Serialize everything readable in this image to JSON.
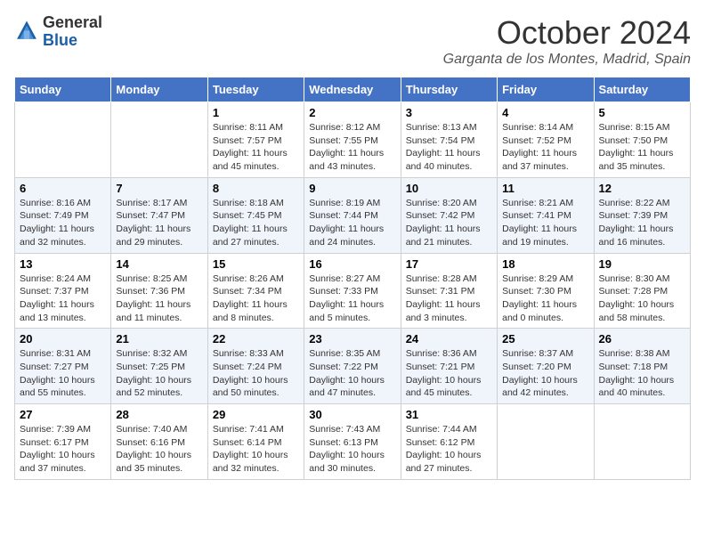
{
  "header": {
    "logo_line1": "General",
    "logo_line2": "Blue",
    "month": "October 2024",
    "location": "Garganta de los Montes, Madrid, Spain"
  },
  "weekdays": [
    "Sunday",
    "Monday",
    "Tuesday",
    "Wednesday",
    "Thursday",
    "Friday",
    "Saturday"
  ],
  "weeks": [
    [
      {
        "day": "",
        "info": ""
      },
      {
        "day": "",
        "info": ""
      },
      {
        "day": "1",
        "info": "Sunrise: 8:11 AM\nSunset: 7:57 PM\nDaylight: 11 hours and 45 minutes."
      },
      {
        "day": "2",
        "info": "Sunrise: 8:12 AM\nSunset: 7:55 PM\nDaylight: 11 hours and 43 minutes."
      },
      {
        "day": "3",
        "info": "Sunrise: 8:13 AM\nSunset: 7:54 PM\nDaylight: 11 hours and 40 minutes."
      },
      {
        "day": "4",
        "info": "Sunrise: 8:14 AM\nSunset: 7:52 PM\nDaylight: 11 hours and 37 minutes."
      },
      {
        "day": "5",
        "info": "Sunrise: 8:15 AM\nSunset: 7:50 PM\nDaylight: 11 hours and 35 minutes."
      }
    ],
    [
      {
        "day": "6",
        "info": "Sunrise: 8:16 AM\nSunset: 7:49 PM\nDaylight: 11 hours and 32 minutes."
      },
      {
        "day": "7",
        "info": "Sunrise: 8:17 AM\nSunset: 7:47 PM\nDaylight: 11 hours and 29 minutes."
      },
      {
        "day": "8",
        "info": "Sunrise: 8:18 AM\nSunset: 7:45 PM\nDaylight: 11 hours and 27 minutes."
      },
      {
        "day": "9",
        "info": "Sunrise: 8:19 AM\nSunset: 7:44 PM\nDaylight: 11 hours and 24 minutes."
      },
      {
        "day": "10",
        "info": "Sunrise: 8:20 AM\nSunset: 7:42 PM\nDaylight: 11 hours and 21 minutes."
      },
      {
        "day": "11",
        "info": "Sunrise: 8:21 AM\nSunset: 7:41 PM\nDaylight: 11 hours and 19 minutes."
      },
      {
        "day": "12",
        "info": "Sunrise: 8:22 AM\nSunset: 7:39 PM\nDaylight: 11 hours and 16 minutes."
      }
    ],
    [
      {
        "day": "13",
        "info": "Sunrise: 8:24 AM\nSunset: 7:37 PM\nDaylight: 11 hours and 13 minutes."
      },
      {
        "day": "14",
        "info": "Sunrise: 8:25 AM\nSunset: 7:36 PM\nDaylight: 11 hours and 11 minutes."
      },
      {
        "day": "15",
        "info": "Sunrise: 8:26 AM\nSunset: 7:34 PM\nDaylight: 11 hours and 8 minutes."
      },
      {
        "day": "16",
        "info": "Sunrise: 8:27 AM\nSunset: 7:33 PM\nDaylight: 11 hours and 5 minutes."
      },
      {
        "day": "17",
        "info": "Sunrise: 8:28 AM\nSunset: 7:31 PM\nDaylight: 11 hours and 3 minutes."
      },
      {
        "day": "18",
        "info": "Sunrise: 8:29 AM\nSunset: 7:30 PM\nDaylight: 11 hours and 0 minutes."
      },
      {
        "day": "19",
        "info": "Sunrise: 8:30 AM\nSunset: 7:28 PM\nDaylight: 10 hours and 58 minutes."
      }
    ],
    [
      {
        "day": "20",
        "info": "Sunrise: 8:31 AM\nSunset: 7:27 PM\nDaylight: 10 hours and 55 minutes."
      },
      {
        "day": "21",
        "info": "Sunrise: 8:32 AM\nSunset: 7:25 PM\nDaylight: 10 hours and 52 minutes."
      },
      {
        "day": "22",
        "info": "Sunrise: 8:33 AM\nSunset: 7:24 PM\nDaylight: 10 hours and 50 minutes."
      },
      {
        "day": "23",
        "info": "Sunrise: 8:35 AM\nSunset: 7:22 PM\nDaylight: 10 hours and 47 minutes."
      },
      {
        "day": "24",
        "info": "Sunrise: 8:36 AM\nSunset: 7:21 PM\nDaylight: 10 hours and 45 minutes."
      },
      {
        "day": "25",
        "info": "Sunrise: 8:37 AM\nSunset: 7:20 PM\nDaylight: 10 hours and 42 minutes."
      },
      {
        "day": "26",
        "info": "Sunrise: 8:38 AM\nSunset: 7:18 PM\nDaylight: 10 hours and 40 minutes."
      }
    ],
    [
      {
        "day": "27",
        "info": "Sunrise: 7:39 AM\nSunset: 6:17 PM\nDaylight: 10 hours and 37 minutes."
      },
      {
        "day": "28",
        "info": "Sunrise: 7:40 AM\nSunset: 6:16 PM\nDaylight: 10 hours and 35 minutes."
      },
      {
        "day": "29",
        "info": "Sunrise: 7:41 AM\nSunset: 6:14 PM\nDaylight: 10 hours and 32 minutes."
      },
      {
        "day": "30",
        "info": "Sunrise: 7:43 AM\nSunset: 6:13 PM\nDaylight: 10 hours and 30 minutes."
      },
      {
        "day": "31",
        "info": "Sunrise: 7:44 AM\nSunset: 6:12 PM\nDaylight: 10 hours and 27 minutes."
      },
      {
        "day": "",
        "info": ""
      },
      {
        "day": "",
        "info": ""
      }
    ]
  ]
}
